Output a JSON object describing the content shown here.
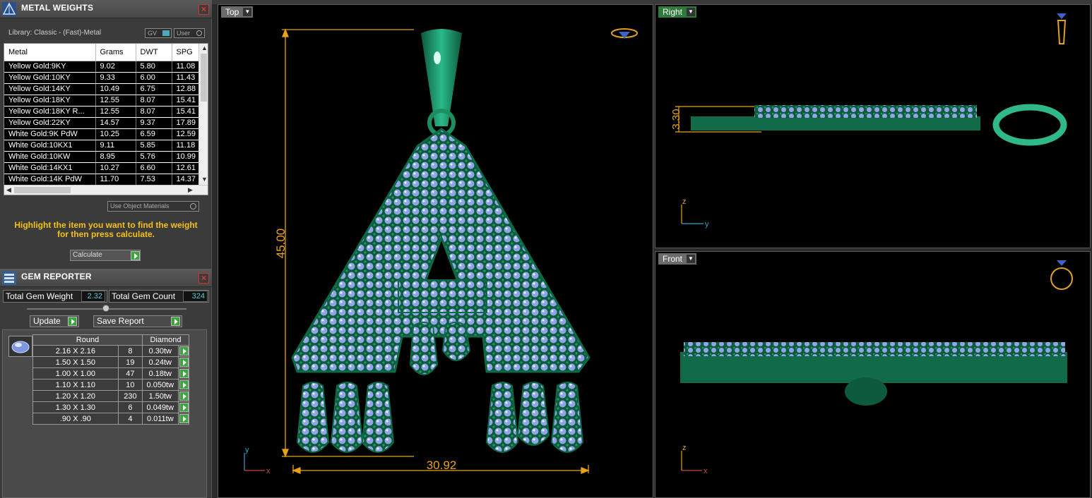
{
  "metal_weights": {
    "title": "METAL WEIGHTS",
    "library_label": "Library: Classic - (Fast)-Metal",
    "gv_label": "GV",
    "user_label": "User",
    "columns": [
      "Metal",
      "Grams",
      "DWT",
      "SPG"
    ],
    "rows": [
      [
        "Yellow Gold:9KY",
        "9.02",
        "5.80",
        "11.08"
      ],
      [
        "Yellow Gold:10KY",
        "9.33",
        "6.00",
        "11.43"
      ],
      [
        "Yellow Gold:14KY",
        "10.49",
        "6.75",
        "12.88"
      ],
      [
        "Yellow Gold:18KY",
        "12.55",
        "8.07",
        "15.41"
      ],
      [
        "Yellow Gold:18KY R...",
        "12.55",
        "8.07",
        "15.41"
      ],
      [
        "Yellow Gold:22KY",
        "14.57",
        "9.37",
        "17.89"
      ],
      [
        "White Gold:9K PdW",
        "10.25",
        "6.59",
        "12.59"
      ],
      [
        "White Gold:10KX1",
        "9.11",
        "5.85",
        "11.18"
      ],
      [
        "White Gold:10KW",
        "8.95",
        "5.76",
        "10.99"
      ],
      [
        "White Gold:14KX1",
        "10.27",
        "6.60",
        "12.61"
      ],
      [
        "White Gold:14K PdW",
        "11.70",
        "7.53",
        "14.37"
      ]
    ],
    "use_object_materials": "Use Object Materials",
    "hint": "Highlight the item you want to find the weight for then press calculate.",
    "calculate_label": "Calculate"
  },
  "gem_reporter": {
    "title": "GEM REPORTER",
    "total_weight_label": "Total Gem Weight",
    "total_weight": "2.32",
    "total_count_label": "Total Gem Count",
    "total_count": "324",
    "update_label": "Update",
    "save_report_label": "Save Report",
    "shape": "Round",
    "stone": "Diamond",
    "rows": [
      [
        "2.16 X 2.16",
        "8",
        "0.30tw"
      ],
      [
        "1.50 X 1.50",
        "19",
        "0.24tw"
      ],
      [
        "1.00 X 1.00",
        "47",
        "0.18tw"
      ],
      [
        "1.10 X 1.10",
        "10",
        "0.050tw"
      ],
      [
        "1.20 X 1.20",
        "230",
        "1.50tw"
      ],
      [
        "1.30 X 1.30",
        "6",
        "0.049tw"
      ],
      [
        ".90 X .90",
        "4",
        "0.011tw"
      ]
    ]
  },
  "viewports": {
    "top": {
      "label": "Top",
      "height_dim": "45.00",
      "width_dim": "30.92",
      "axis_y": "y",
      "axis_x": "x"
    },
    "right": {
      "label": "Right",
      "thickness_dim": "3.30",
      "axis_z": "z",
      "axis_y": "y"
    },
    "front": {
      "label": "Front",
      "axis_z": "z",
      "axis_x": "x"
    }
  },
  "colors": {
    "metal": "#1f8a5a",
    "gem": "#8fa8e8",
    "dimension": "#e8a21a",
    "hint": "#f4c11a"
  }
}
